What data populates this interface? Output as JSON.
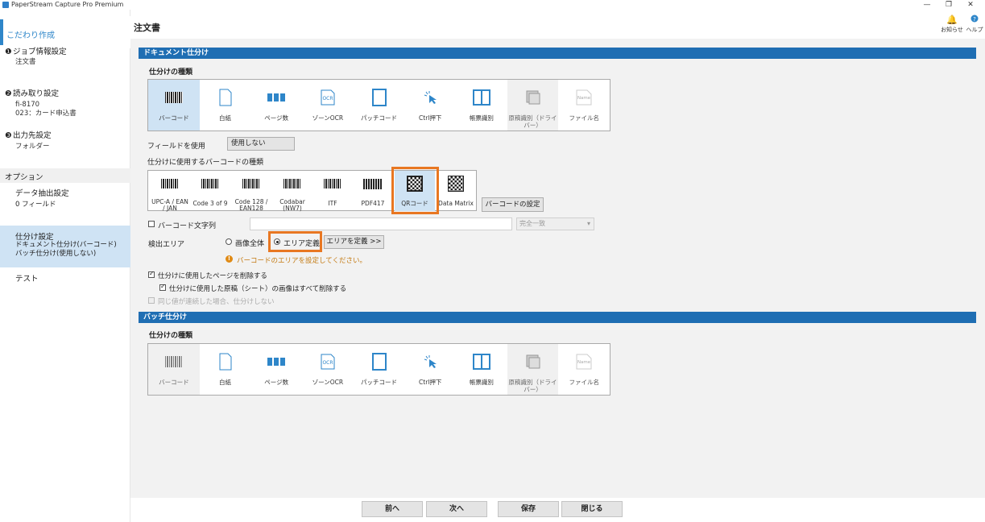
{
  "window": {
    "title": "PaperStream Capture Pro Premium",
    "buttons": [
      "—",
      "❐",
      "✕"
    ]
  },
  "sidebar": {
    "active_title": "こだわり作成",
    "sections": [
      {
        "num": "❶",
        "label": "ジョブ情報設定",
        "sub": [
          "注文書"
        ]
      },
      {
        "num": "❷",
        "label": "読み取り設定",
        "sub": [
          "fi-8170",
          "023：カード申込書"
        ]
      },
      {
        "num": "❸",
        "label": "出力先設定",
        "sub": [
          "フォルダー"
        ]
      }
    ],
    "options_header": "オプション",
    "items": [
      {
        "label": "データ抽出設定",
        "sub": "0 フィールド"
      },
      {
        "label": "仕分け設定",
        "sub1": "ドキュメント仕分け(バーコード)",
        "sub2": "バッチ仕分け(使用しない)"
      },
      {
        "label": "テスト"
      }
    ]
  },
  "header": {
    "title": "注文書",
    "notify_label": "お知らせ",
    "help_label": "ヘルプ",
    "notify_icon": "bell-icon",
    "help_icon": "help-icon"
  },
  "doc_sort": {
    "section_title": "ドキュメント仕分け",
    "type_heading": "仕分けの種類",
    "types": [
      "バーコード",
      "白紙",
      "ページ数",
      "ゾーンOCR",
      "パッチコード",
      "Ctrl押下",
      "帳票識別",
      "原稿識別（ドライバー）",
      "ファイル名"
    ],
    "field_label": "フィールドを使用",
    "field_value": "使用しない",
    "barcode_heading": "仕分けに使用するバーコードの種類",
    "barcodes": [
      "UPC-A / EAN / JAN",
      "Code 3 of 9",
      "Code 128 / EAN128",
      "Codabar (NW7)",
      "ITF",
      "PDF417",
      "QRコード",
      "Data Matrix"
    ],
    "barcode_settings_button": "バーコードの設定",
    "barcode_string_label": "バーコード文字列",
    "match_select": "完全一致",
    "detect_area_label": "検出エリア",
    "radio_whole": "画像全体",
    "radio_area": "エリア定義",
    "define_area_button": "エリアを定義 >>",
    "warning": "バーコードのエリアを設定してください。",
    "delete_page": "仕分けに使用したページを削除する",
    "delete_all_images": "仕分けに使用した原稿（シート）の画像はすべて削除する",
    "no_sort_same": "同じ値が連続した場合、仕分けしない"
  },
  "batch_sort": {
    "section_title": "バッチ仕分け",
    "type_heading": "仕分けの種類",
    "types": [
      "バーコード",
      "白紙",
      "ページ数",
      "ゾーンOCR",
      "パッチコード",
      "Ctrl押下",
      "帳票識別",
      "原稿識別（ドライバー）",
      "ファイル名"
    ]
  },
  "footer": {
    "prev": "前へ",
    "next": "次へ",
    "save": "保存",
    "close": "閉じる"
  },
  "colors": {
    "accent": "#1f6eb3",
    "highlight": "#e87722",
    "selected": "#cfe3f4"
  }
}
